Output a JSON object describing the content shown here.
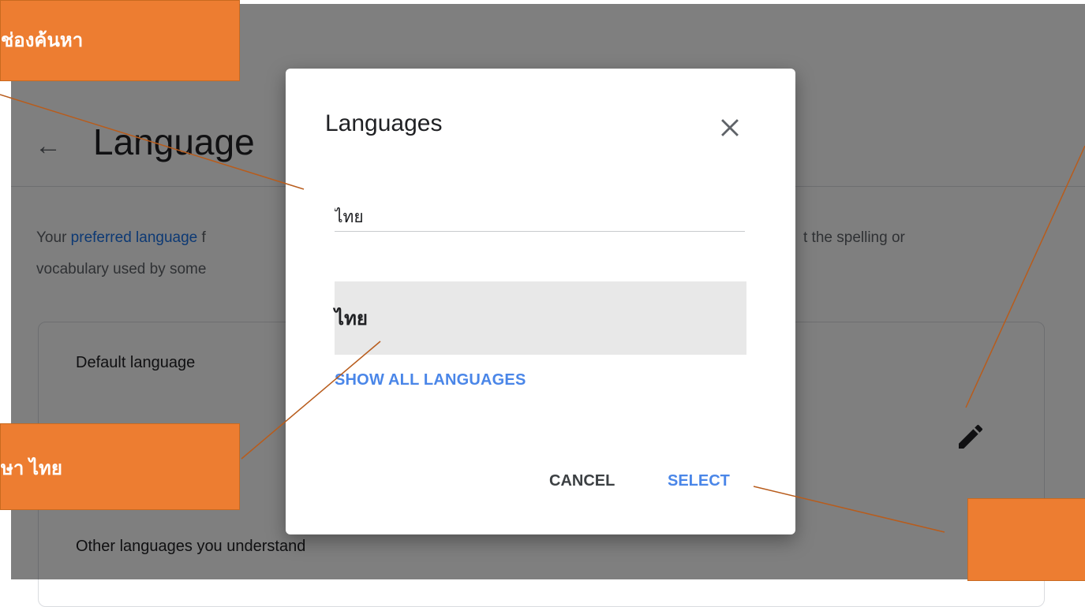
{
  "page": {
    "back_icon": "arrow-left-icon",
    "title": "Language",
    "intro_line1_prefix": "Your",
    "intro_link": "preferred language",
    "intro_line1_suffix": "f",
    "intro_line1_right": "t the spelling or",
    "intro_line2": "vocabulary used by some",
    "default_heading": "Default language",
    "other_heading": "Other languages you understand",
    "edit_icon": "pencil-icon"
  },
  "dialog": {
    "title": "Languages",
    "close_icon": "close-icon",
    "search_value": "ไทย",
    "result_label": "ไทย",
    "show_all_label": "SHOW ALL LANGUAGES",
    "cancel_label": "CANCEL",
    "select_label": "SELECT"
  },
  "callouts": {
    "search": "ช่องค้นหา",
    "thai": "ษา ไทย",
    "select": ""
  },
  "colors": {
    "accent_blue": "#4a86e8",
    "link_blue": "#1a73e8",
    "callout_orange": "#ed7d31",
    "leader_line": "#b85c1c",
    "scrim": "rgba(0,0,0,0.5)"
  }
}
